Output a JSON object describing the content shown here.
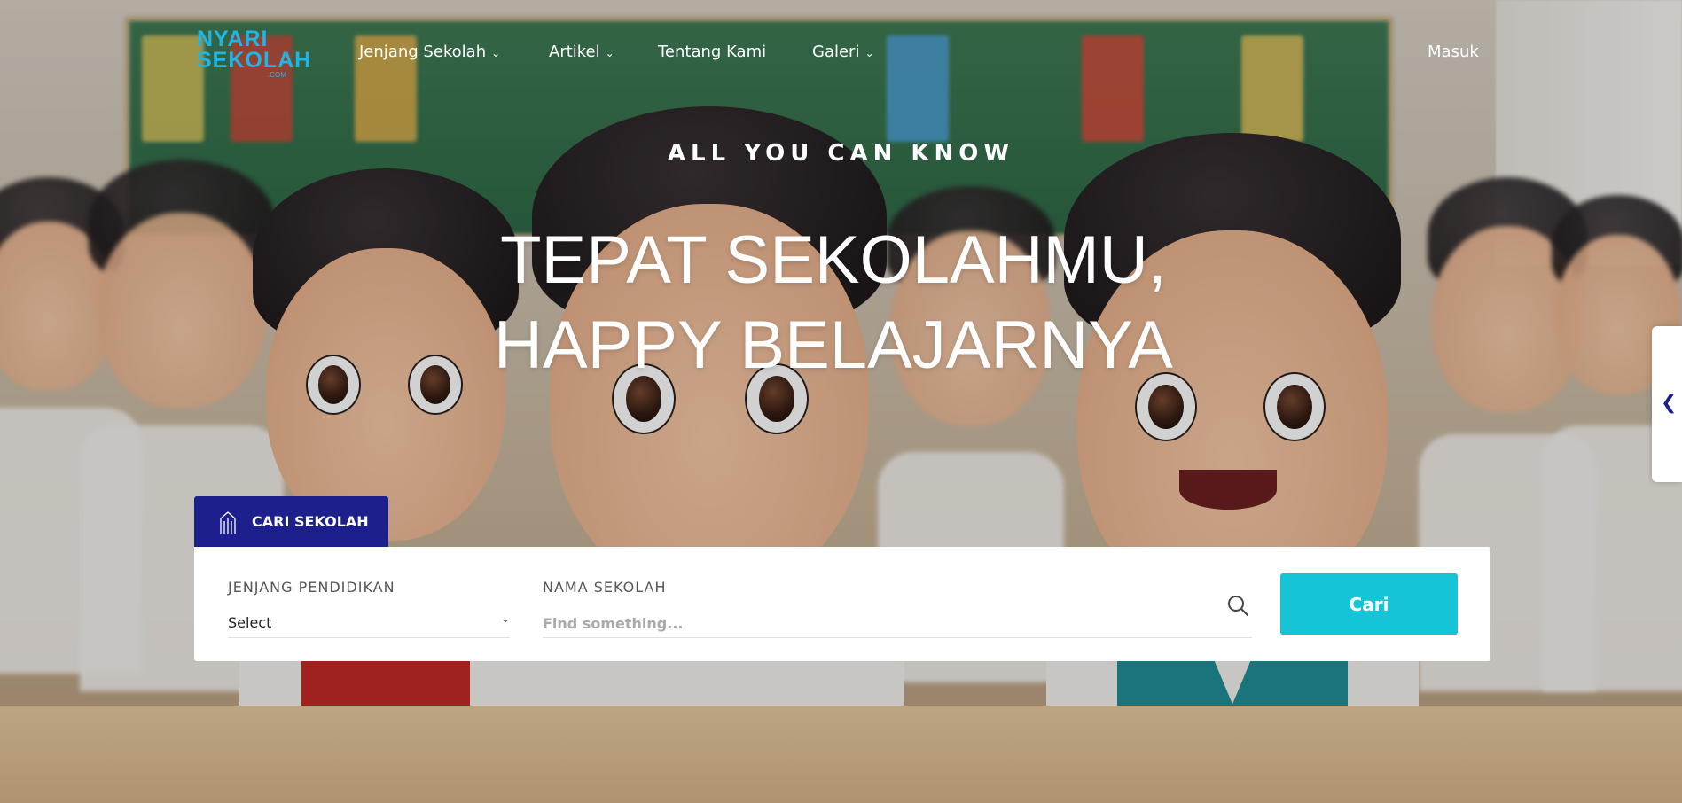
{
  "brand": {
    "line1": "NYARI",
    "line2": "SEKOLAH",
    "line3": ".COM",
    "color": "#1fb6e6"
  },
  "nav": {
    "items": [
      {
        "label": "Jenjang Sekolah",
        "has_dropdown": true
      },
      {
        "label": "Artikel",
        "has_dropdown": true
      },
      {
        "label": "Tentang Kami",
        "has_dropdown": false
      },
      {
        "label": "Galeri",
        "has_dropdown": true
      }
    ],
    "login_label": "Masuk",
    "dropdown_icon": "chevron-down-icon"
  },
  "hero": {
    "eyebrow": "ALL YOU CAN KNOW",
    "headline_line1": "TEPAT SEKOLAHMU,",
    "headline_line2": "HAPPY BELAJARNYA"
  },
  "side_tab": {
    "icon": "chevron-left-icon"
  },
  "search": {
    "tab_label": "CARI SEKOLAH",
    "tab_icon": "building-icon",
    "jenjang_label": "JENJANG PENDIDIKAN",
    "jenjang_selected": "Select",
    "nama_label": "NAMA SEKOLAH",
    "nama_placeholder": "Find something...",
    "nama_value": "",
    "search_icon": "search-icon",
    "button_label": "Cari"
  },
  "colors": {
    "primary_navy": "#1d1f8c",
    "accent_cyan": "#16c4d7",
    "white": "#ffffff"
  }
}
